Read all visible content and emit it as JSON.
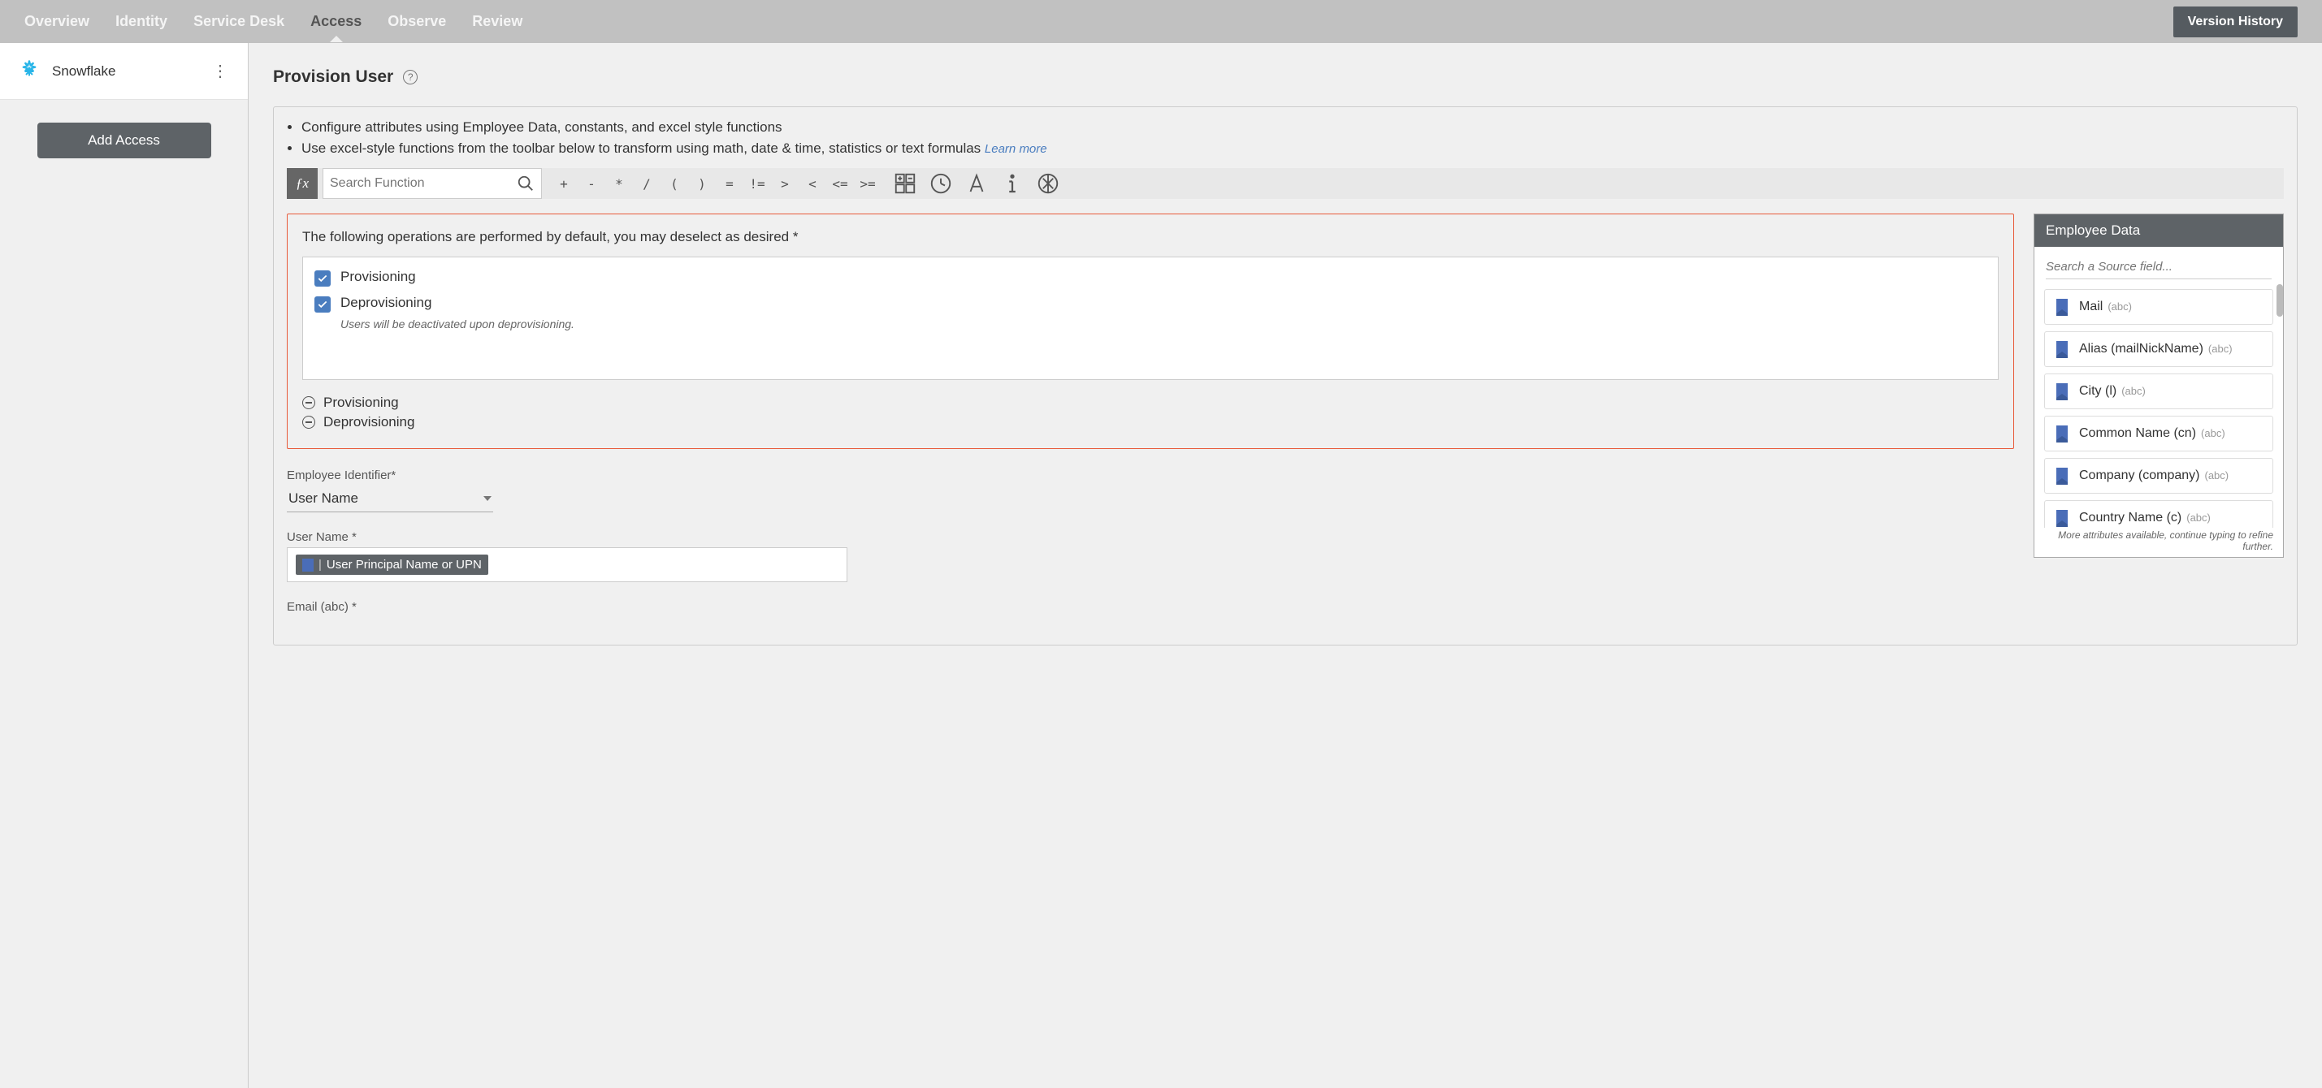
{
  "topbar": {
    "tabs": [
      "Overview",
      "Identity",
      "Service Desk",
      "Access",
      "Observe",
      "Review"
    ],
    "active_tab": "Access",
    "version_history": "Version History"
  },
  "sidebar": {
    "app_name": "Snowflake",
    "add_access": "Add Access"
  },
  "page": {
    "title": "Provision User",
    "instructions": [
      "Configure attributes using Employee Data, constants, and excel style functions",
      "Use excel-style functions from the toolbar below to transform using math, date & time, statistics or text formulas"
    ],
    "learn_more": "Learn more",
    "search_fn_placeholder": "Search Function",
    "operators": [
      "+",
      "-",
      "*",
      "/",
      "(",
      ")",
      "=",
      "!=",
      ">",
      "<",
      "<=",
      ">="
    ]
  },
  "operations": {
    "desc": "The following operations are performed by default, you may deselect as desired *",
    "items": [
      {
        "label": "Provisioning",
        "checked": true,
        "note": ""
      },
      {
        "label": "Deprovisioning",
        "checked": true,
        "note": "Users will be deactivated upon deprovisioning."
      }
    ],
    "collapsed": [
      "Provisioning",
      "Deprovisioning"
    ]
  },
  "fields": {
    "employee_identifier": {
      "label": "Employee Identifier*",
      "value": "User Name"
    },
    "user_name": {
      "label": "User Name *",
      "chip": "User Principal Name or UPN"
    },
    "email": {
      "label": "Email (abc) *"
    }
  },
  "employee_data": {
    "title": "Employee Data",
    "search_placeholder": "Search a Source field...",
    "items": [
      {
        "label": "Mail",
        "type": "(abc)"
      },
      {
        "label": "Alias (mailNickName)",
        "type": "(abc)"
      },
      {
        "label": "City (l)",
        "type": "(abc)"
      },
      {
        "label": "Common Name (cn)",
        "type": "(abc)"
      },
      {
        "label": "Company (company)",
        "type": "(abc)"
      },
      {
        "label": "Country Name (c)",
        "type": "(abc)"
      }
    ],
    "footer": "More attributes available, continue typing to refine further."
  }
}
